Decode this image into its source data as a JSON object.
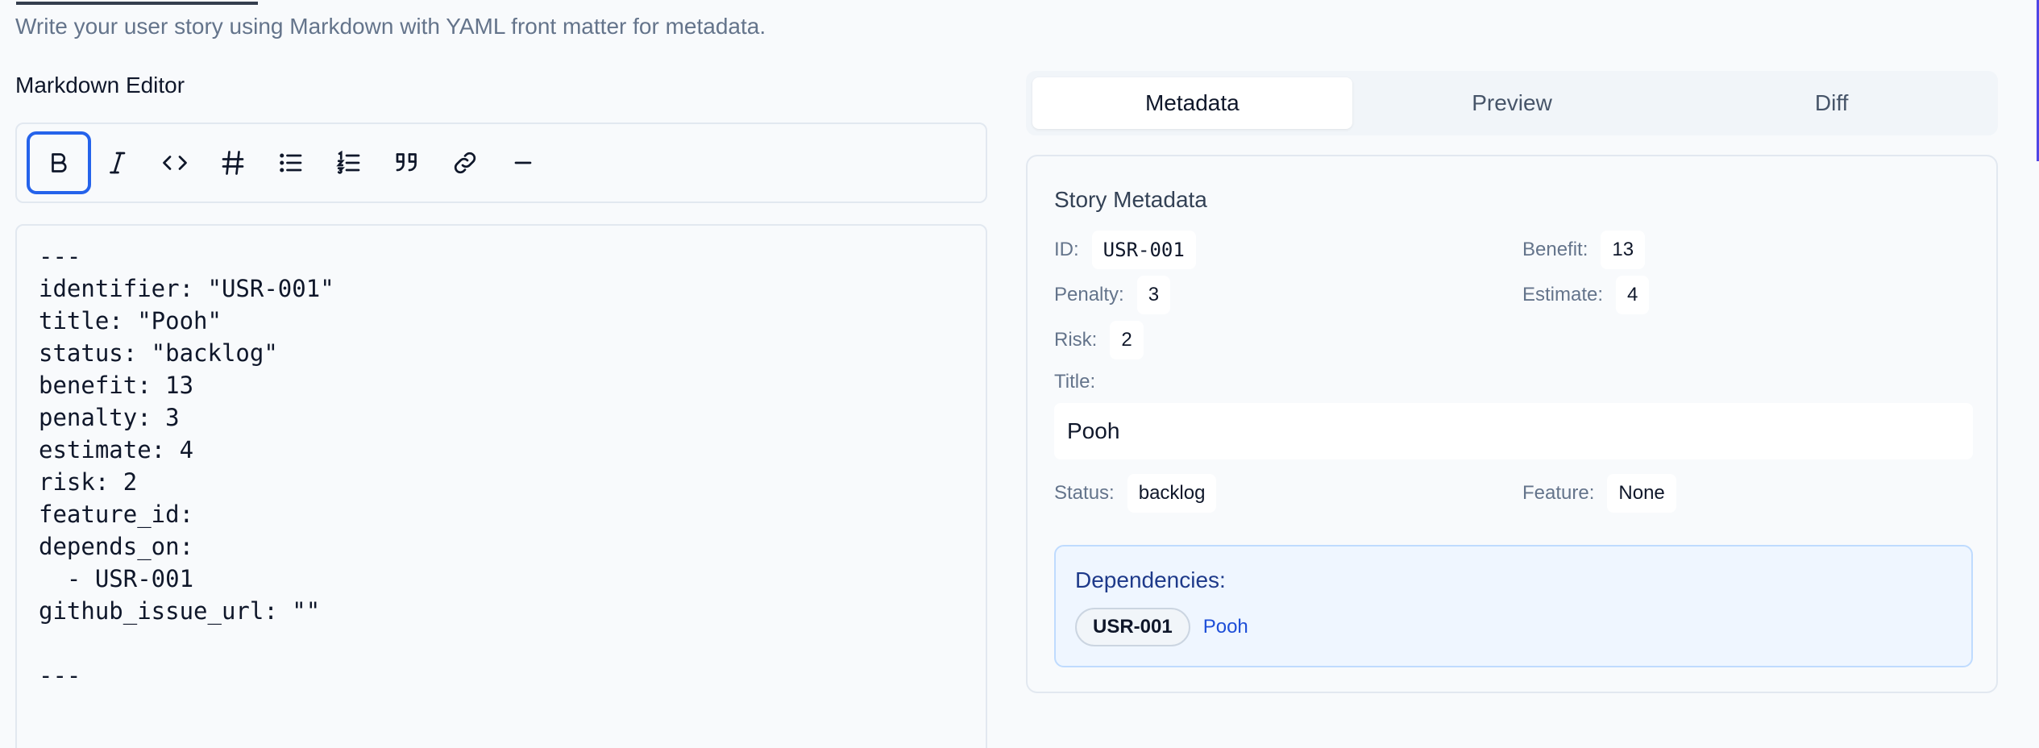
{
  "header": {
    "subtitle": "Write your user story using Markdown with YAML front matter for metadata."
  },
  "editor": {
    "label": "Markdown Editor",
    "toolbar": [
      {
        "name": "bold",
        "icon": "bold-icon"
      },
      {
        "name": "italic",
        "icon": "italic-icon"
      },
      {
        "name": "code",
        "icon": "code-icon"
      },
      {
        "name": "heading",
        "icon": "heading-icon"
      },
      {
        "name": "bullet-list",
        "icon": "bullet-list-icon"
      },
      {
        "name": "numbered-list",
        "icon": "numbered-list-icon"
      },
      {
        "name": "quote",
        "icon": "quote-icon"
      },
      {
        "name": "link",
        "icon": "link-icon"
      },
      {
        "name": "horizontal-rule",
        "icon": "horizontal-rule-icon"
      }
    ],
    "content": "---\nidentifier: \"USR-001\"\ntitle: \"Pooh\"\nstatus: \"backlog\"\nbenefit: 13\npenalty: 3\nestimate: 4\nrisk: 2\nfeature_id:\ndepends_on:\n  - USR-001\ngithub_issue_url: \"\"\n\n---"
  },
  "tabs": [
    "Metadata",
    "Preview",
    "Diff"
  ],
  "metadata": {
    "heading": "Story Metadata",
    "id_label": "ID:",
    "id_value": "USR-001",
    "benefit_label": "Benefit:",
    "benefit_value": "13",
    "penalty_label": "Penalty:",
    "penalty_value": "3",
    "estimate_label": "Estimate:",
    "estimate_value": "4",
    "risk_label": "Risk:",
    "risk_value": "2",
    "title_label": "Title:",
    "title_value": "Pooh",
    "status_label": "Status:",
    "status_value": "backlog",
    "feature_label": "Feature:",
    "feature_value": "None"
  },
  "dependencies": {
    "heading": "Dependencies:",
    "items": [
      {
        "id": "USR-001",
        "title": "Pooh"
      }
    ]
  },
  "colors": {
    "accent": "#2563eb",
    "deps_bg": "#eff6ff",
    "deps_border": "#bfdbfe"
  }
}
